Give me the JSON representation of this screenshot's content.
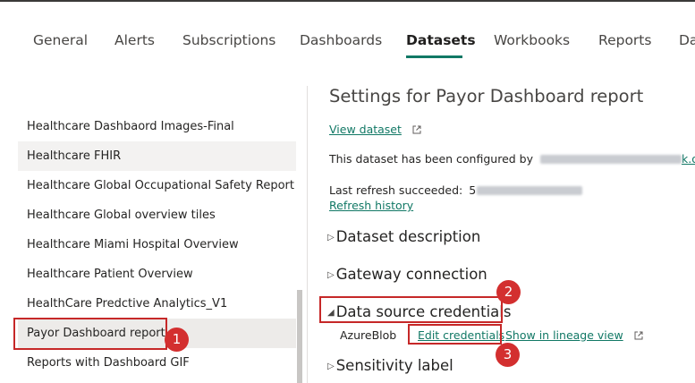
{
  "tabs": [
    {
      "label": "General"
    },
    {
      "label": "Alerts"
    },
    {
      "label": "Subscriptions"
    },
    {
      "label": "Dashboards"
    },
    {
      "label": "Datasets",
      "active": true
    },
    {
      "label": "Workbooks"
    },
    {
      "label": "Reports"
    },
    {
      "label": "Da"
    }
  ],
  "datasets_list": [
    "Healthcare Dashbaord Images-Final",
    "Healthcare FHIR",
    "Healthcare Global Occupational Safety Report",
    "Healthcare Global overview tiles",
    "Healthcare Miami Hospital Overview",
    "Healthcare Patient Overview",
    "HealthCare Predctive Analytics_V1",
    "Payor Dashboard report",
    "Reports with Dashboard GIF"
  ],
  "settings": {
    "title": "Settings for Payor Dashboard report",
    "view_dataset": "View dataset",
    "configured_by_prefix": "This dataset has been configured by",
    "configured_by_suffix": "k.onm",
    "last_refresh_prefix": "Last refresh succeeded:",
    "last_refresh_partial": "5",
    "refresh_history": "Refresh history",
    "dataset_description": "Dataset description",
    "gateway_connection": "Gateway connection",
    "data_source_credentials": "Data source credentials",
    "azureblob": "AzureBlob",
    "edit_credentials": "Edit credentials",
    "show_lineage": "Show in lineage view",
    "sensitivity_label": "Sensitivity label"
  },
  "callouts": [
    "1",
    "2",
    "3"
  ],
  "colors": {
    "accent": "#117865",
    "callout": "#d32f2f"
  }
}
